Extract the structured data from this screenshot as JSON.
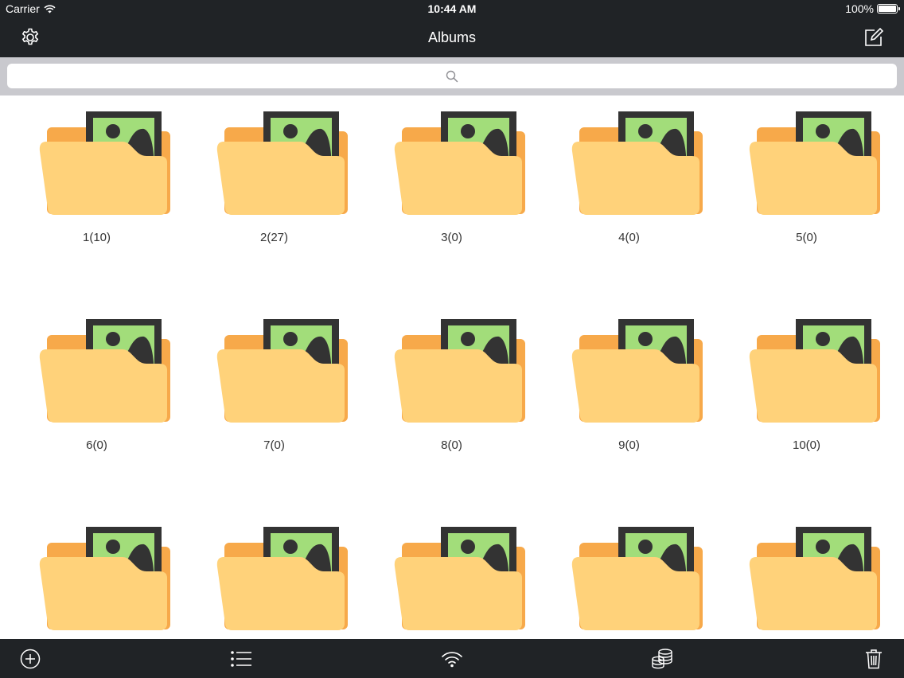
{
  "status_bar": {
    "carrier": "Carrier",
    "time": "10:44 AM",
    "battery": "100%"
  },
  "nav": {
    "title": "Albums",
    "left_icon": "gear-icon",
    "right_icon": "compose-icon"
  },
  "search": {
    "value": "",
    "placeholder": ""
  },
  "albums": [
    {
      "label": "1(10)"
    },
    {
      "label": "2(27)"
    },
    {
      "label": "3(0)"
    },
    {
      "label": "4(0)"
    },
    {
      "label": "5(0)"
    },
    {
      "label": "6(0)"
    },
    {
      "label": "7(0)"
    },
    {
      "label": "8(0)"
    },
    {
      "label": "9(0)"
    },
    {
      "label": "10(0)"
    },
    {
      "label": ""
    },
    {
      "label": ""
    },
    {
      "label": ""
    },
    {
      "label": ""
    },
    {
      "label": ""
    }
  ],
  "toolbar": {
    "icons": [
      "add-circle-icon",
      "list-icon",
      "wifi-icon",
      "coins-icon",
      "trash-icon"
    ]
  },
  "colors": {
    "bar_background": "#202326",
    "search_background": "#c9c9ce",
    "folder_front": "#ffd27a",
    "folder_back": "#f7a94a",
    "photo_green": "#a2dd7a",
    "photo_frame": "#333333"
  }
}
